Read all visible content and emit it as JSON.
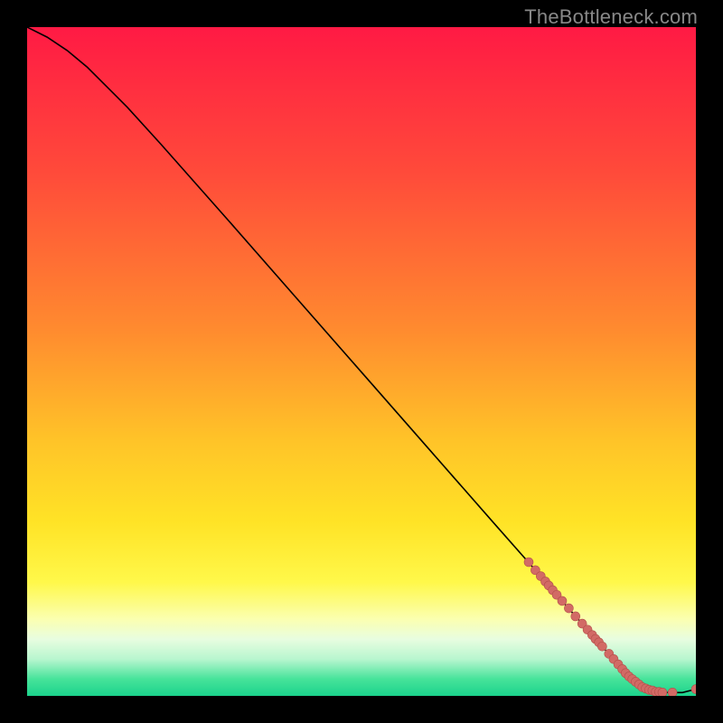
{
  "watermark": "TheBottleneck.com",
  "colors": {
    "frame": "#000000",
    "curve": "#000000",
    "marker_fill": "#d26a65",
    "marker_stroke": "#b24f4a",
    "gradient_stops": [
      {
        "offset": 0.0,
        "color": "#ff1a44"
      },
      {
        "offset": 0.22,
        "color": "#ff4b3a"
      },
      {
        "offset": 0.45,
        "color": "#ff8a2f"
      },
      {
        "offset": 0.62,
        "color": "#ffc428"
      },
      {
        "offset": 0.74,
        "color": "#ffe326"
      },
      {
        "offset": 0.83,
        "color": "#fff84a"
      },
      {
        "offset": 0.885,
        "color": "#fbffb0"
      },
      {
        "offset": 0.915,
        "color": "#e8fde0"
      },
      {
        "offset": 0.945,
        "color": "#b8f6cf"
      },
      {
        "offset": 0.975,
        "color": "#46e39a"
      },
      {
        "offset": 1.0,
        "color": "#1bd38c"
      }
    ]
  },
  "chart_data": {
    "type": "line",
    "xlabel": "",
    "ylabel": "",
    "xlim": [
      0,
      100
    ],
    "ylim": [
      0,
      100
    ],
    "title": "",
    "series": [
      {
        "name": "curve",
        "x": [
          0,
          3,
          6,
          9,
          12,
          15,
          20,
          30,
          40,
          50,
          60,
          70,
          76,
          80,
          82,
          84,
          86,
          88,
          90,
          92,
          94,
          96,
          98,
          100
        ],
        "y": [
          100,
          98.5,
          96.5,
          94.0,
          91.0,
          88.0,
          82.5,
          71.2,
          59.8,
          48.4,
          37.0,
          25.6,
          18.8,
          14.2,
          11.9,
          9.7,
          7.4,
          5.1,
          2.9,
          1.3,
          0.6,
          0.5,
          0.5,
          1.0
        ]
      }
    ],
    "markers": {
      "name": "points",
      "x": [
        75,
        76,
        76.8,
        77.5,
        78,
        78.6,
        79.2,
        80,
        81,
        82,
        83,
        83.8,
        84.5,
        85,
        85.5,
        86,
        87,
        87.7,
        88.4,
        89,
        89.5,
        90,
        90.5,
        91,
        91.5,
        92,
        92.5,
        93,
        93.5,
        94,
        94.5,
        95,
        96.5,
        100
      ],
      "y": [
        20.0,
        18.8,
        17.9,
        17.1,
        16.5,
        15.8,
        15.1,
        14.2,
        13.1,
        11.9,
        10.8,
        9.9,
        9.1,
        8.5,
        8.0,
        7.4,
        6.3,
        5.5,
        4.7,
        4.0,
        3.4,
        2.9,
        2.5,
        2.1,
        1.7,
        1.3,
        1.1,
        0.9,
        0.8,
        0.6,
        0.6,
        0.5,
        0.5,
        1.0
      ]
    }
  }
}
